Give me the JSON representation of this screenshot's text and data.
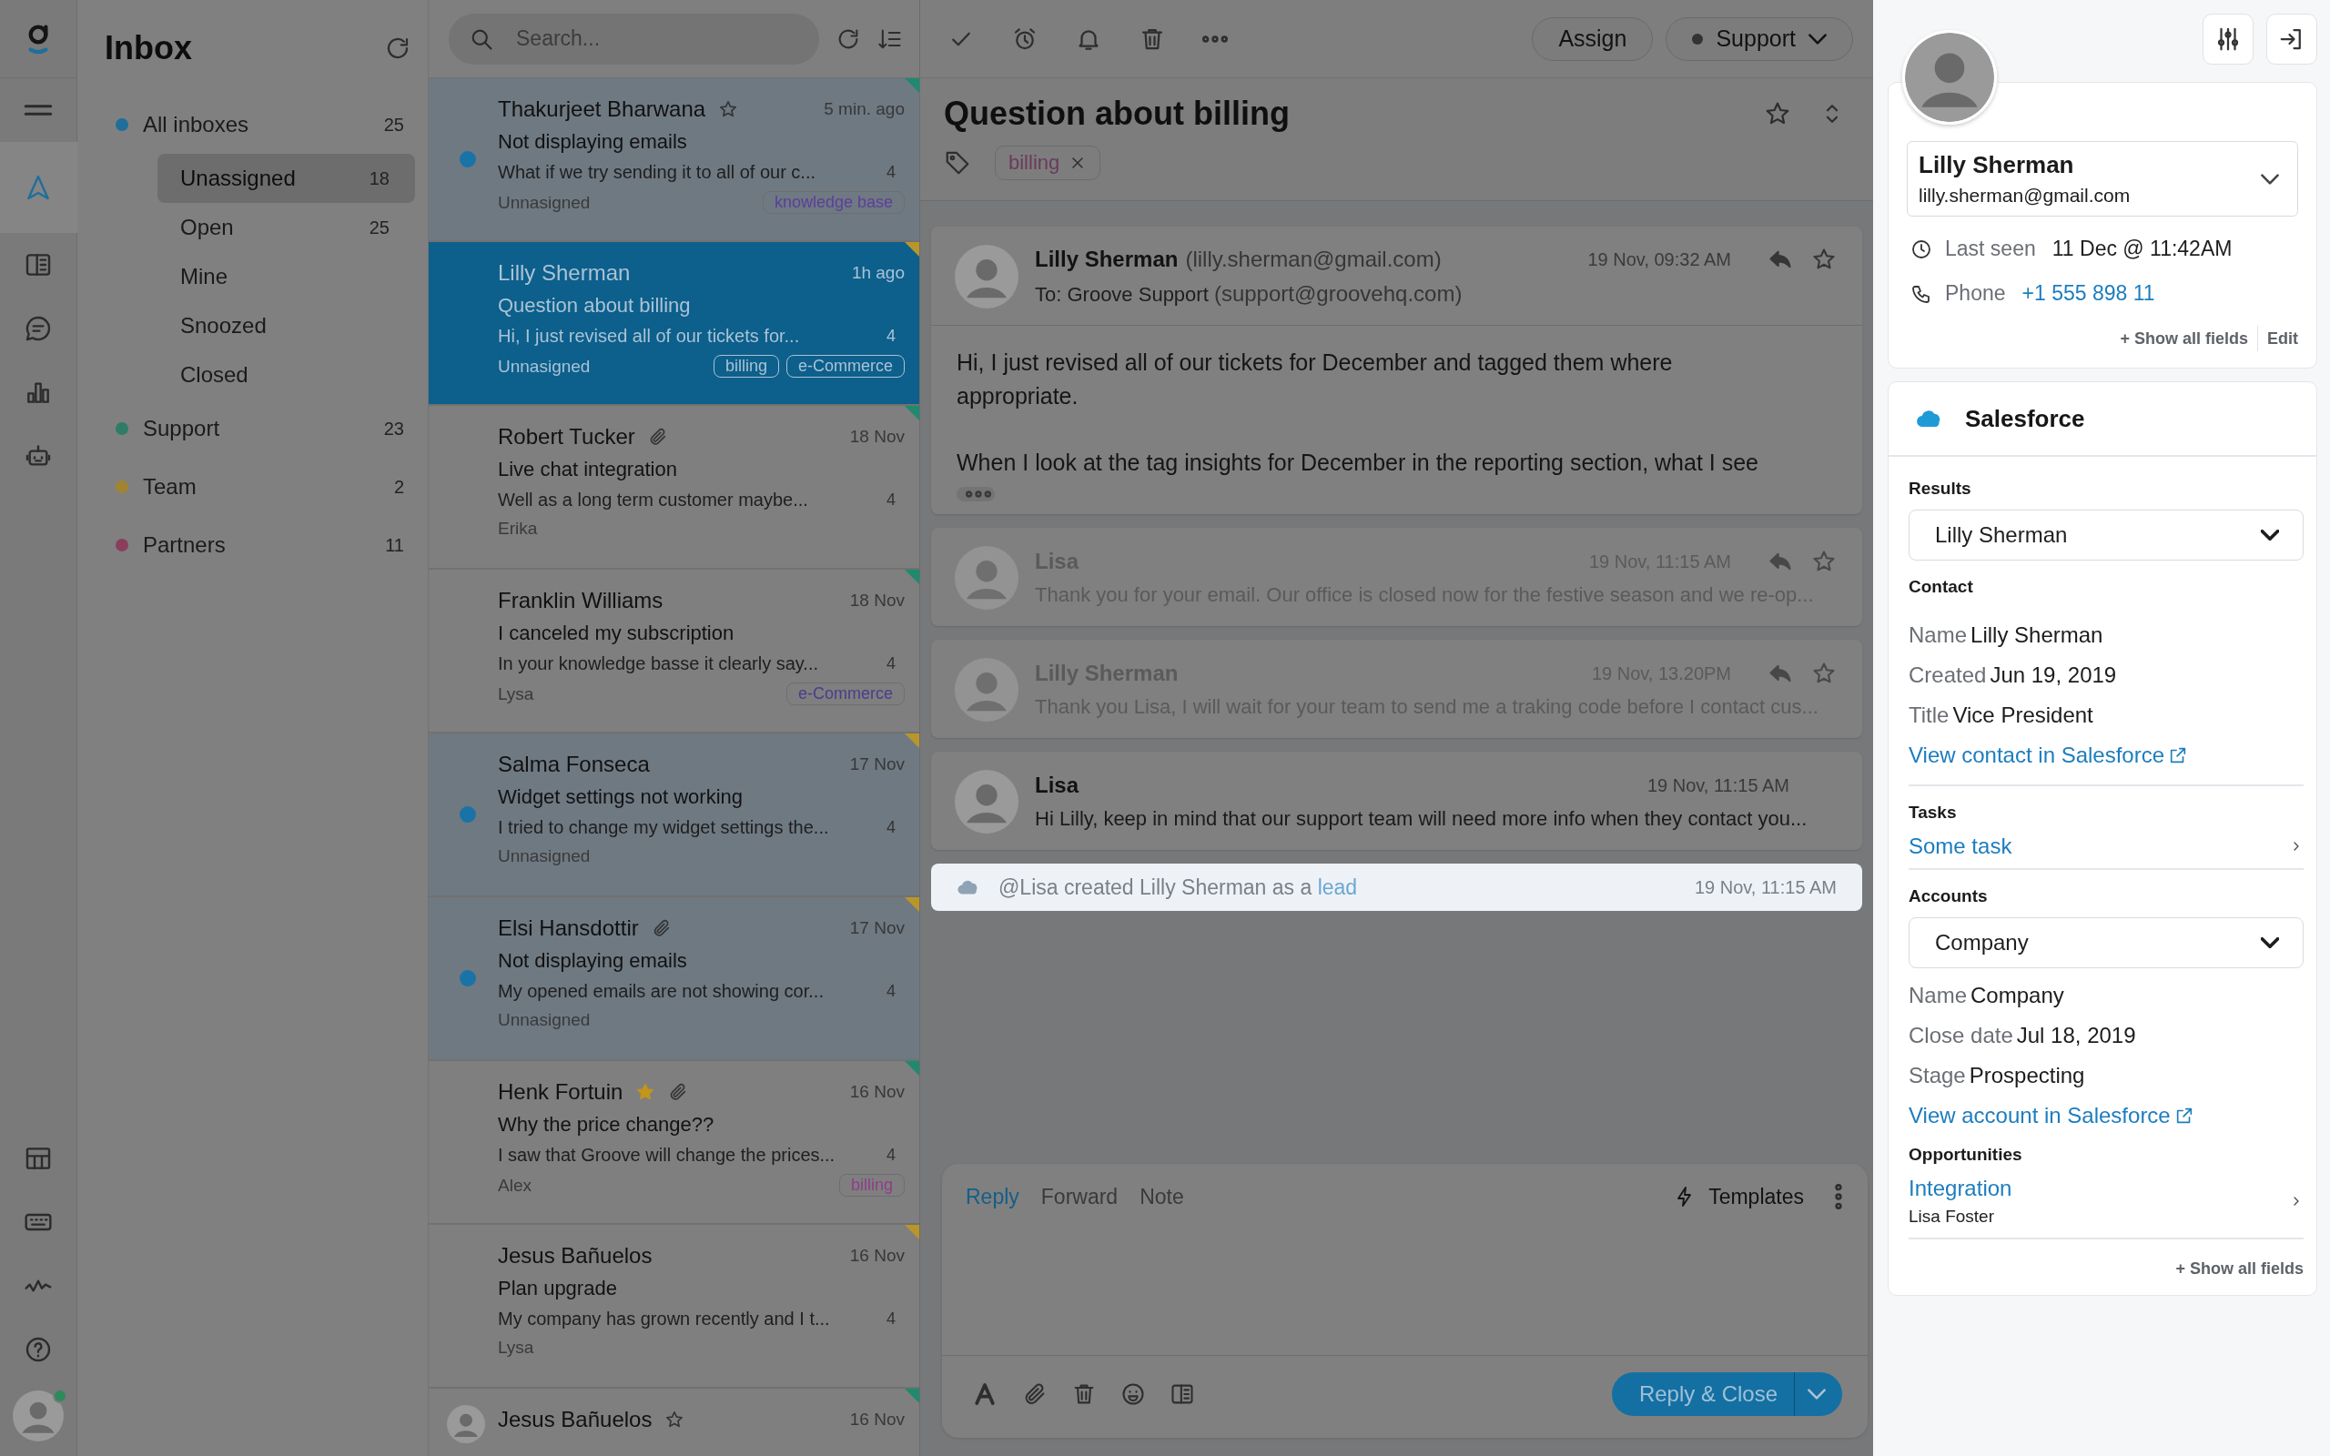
{
  "rail": {
    "top_items": [
      {
        "kind": "menu",
        "selected": false
      },
      {
        "kind": "send",
        "selected": true
      },
      {
        "kind": "book",
        "selected": false
      },
      {
        "kind": "chat",
        "selected": false
      },
      {
        "kind": "chart",
        "selected": false
      },
      {
        "kind": "bot",
        "selected": false
      }
    ],
    "bottom_items": [
      {
        "kind": "table"
      },
      {
        "kind": "keyboard"
      },
      {
        "kind": "activity"
      },
      {
        "kind": "help"
      }
    ],
    "user": {
      "online": true
    }
  },
  "sidebar": {
    "title": "Inbox",
    "items": [
      {
        "label": "All inboxes",
        "count": "25",
        "color": "#1f6f9a",
        "children": [
          {
            "label": "Unassigned",
            "count": "18",
            "selected": true
          },
          {
            "label": "Open",
            "count": "25",
            "selected": false
          },
          {
            "label": "Mine",
            "selected": false
          },
          {
            "label": "Snoozed",
            "selected": false
          },
          {
            "label": "Closed",
            "selected": false
          }
        ]
      },
      {
        "label": "Support",
        "count": "23",
        "color": "#2e7c68"
      },
      {
        "label": "Team",
        "count": "2",
        "color": "#a08432"
      },
      {
        "label": "Partners",
        "count": "11",
        "color": "#8a3e5c"
      }
    ]
  },
  "search": {
    "placeholder": "Search..."
  },
  "conversations": [
    {
      "name": "Thakurjeet Bharwana",
      "starred": false,
      "attachment": false,
      "time": "5 min. ago",
      "subject": "Not displaying emails",
      "preview": "What if we try sending it to all of our c...",
      "count": "4",
      "assignee": "Unnasigned",
      "tags": [
        {
          "label": "knowledge base",
          "color": "#5b3f9a"
        }
      ],
      "unread": true,
      "selected": false,
      "color": "#1f8a6e"
    },
    {
      "name": "Lilly Sherman",
      "attachment": false,
      "time": "1h ago",
      "subject": "Question about billing",
      "preview": "Hi, I just revised all of our tickets for...",
      "count": "4",
      "assignee": "Unnasigned",
      "tags": [
        {
          "label": "billing",
          "color": "#a9c3d4"
        },
        {
          "label": "e-Commerce",
          "color": "#a9c3d4"
        }
      ],
      "unread": false,
      "selected": true,
      "color": "#b8962a"
    },
    {
      "name": "Robert Tucker",
      "attachment": true,
      "time": "18 Nov",
      "subject": "Live chat integration",
      "preview": "Well as a long term customer maybe...",
      "count": "4",
      "assignee": "Erika",
      "unread": false,
      "selected": false,
      "color": "#1f8a6e"
    },
    {
      "name": "Franklin Williams",
      "attachment": false,
      "time": "18 Nov",
      "subject": "I canceled my subscription",
      "preview": "In your knowledge basse it clearly say...",
      "count": "4",
      "assignee": "Lysa",
      "tags": [
        {
          "label": "e-Commerce",
          "color": "#4a3d8c"
        }
      ],
      "unread": false,
      "selected": false,
      "color": "#1f8a6e"
    },
    {
      "name": "Salma Fonseca",
      "attachment": false,
      "time": "17 Nov",
      "subject": "Widget settings not working",
      "preview": "I tried to change my widget settings the...",
      "count": "4",
      "assignee": "Unnasigned",
      "unread": true,
      "selected": false,
      "color": "#b8962a"
    },
    {
      "name": "Elsi Hansdottir",
      "attachment": true,
      "time": "17 Nov",
      "subject": "Not displaying emails",
      "preview": "My opened emails are not showing cor...",
      "count": "4",
      "assignee": "Unnasigned",
      "unread": true,
      "selected": false,
      "color": "#b8962a"
    },
    {
      "name": "Henk Fortuin",
      "starred": true,
      "attachment": true,
      "time": "16 Nov",
      "subject": "Why the price change??",
      "preview": "I saw that Groove will change the prices...",
      "count": "4",
      "assignee": "Alex",
      "tags": [
        {
          "label": "billing",
          "color": "#8e3e8a"
        }
      ],
      "unread": false,
      "selected": false,
      "color": "#1f8a6e"
    },
    {
      "name": "Jesus Bañuelos",
      "attachment": false,
      "time": "16 Nov",
      "subject": "Plan upgrade",
      "preview": "My company has grown recently and I t...",
      "count": "4",
      "assignee": "Lysa",
      "unread": false,
      "selected": false,
      "color": "#b8962a"
    },
    {
      "name": "Jesus Bañuelos",
      "starred": false,
      "avatar": true,
      "attachment": false,
      "time": "16 Nov",
      "unread": false,
      "selected": false,
      "color": "#1f8a6e"
    }
  ],
  "conversation": {
    "toolbar": {
      "assign": "Assign",
      "mailbox": "Support"
    },
    "title": "Question about billing",
    "tags": [
      "billing"
    ],
    "messages": [
      {
        "kind": "expanded",
        "name": "Lilly Sherman",
        "email": "(lilly.sherman@gmail.com)",
        "to": "To: Groove Support",
        "to_email": "(support@groovehq.com)",
        "time": "19 Nov, 09:32 AM",
        "actions": true,
        "faded": false,
        "body": [
          "Hi, I just revised all of our tickets for December and tagged them where appropriate.",
          "When I look at the tag insights for December in the reporting section, what I see"
        ]
      },
      {
        "kind": "collapsed",
        "name": "Lisa",
        "time": "19 Nov, 11:15 AM",
        "actions": true,
        "faded": true,
        "preview": "Thank you for your email. Our office is closed now for the festive season and we re-op..."
      },
      {
        "kind": "collapsed",
        "name": "Lilly Sherman",
        "time": "19 Nov, 13.20PM",
        "actions": true,
        "faded": true,
        "preview": "Thank you Lisa, I will wait for your team to send me a traking code before I contact cus..."
      },
      {
        "kind": "collapsed",
        "name": "Lisa",
        "time": "19 Nov, 11:15 AM",
        "actions": false,
        "faded": false,
        "preview": "Hi Lilly, keep in mind that our support team will need more info when they contact you..."
      },
      {
        "kind": "note",
        "text": "@Lisa created Lilly Sherman as a",
        "link": "lead",
        "time": "19 Nov, 11:15 AM"
      }
    ],
    "composer": {
      "tabs": [
        {
          "label": "Reply",
          "selected": true
        },
        {
          "label": "Forward",
          "selected": false
        },
        {
          "label": "Note",
          "selected": false
        }
      ],
      "templates": "Templates",
      "send": "Reply & Close"
    }
  },
  "contact": {
    "name": "Lilly Sherman",
    "email": "lilly.sherman@gmail.com",
    "last_seen_label": "Last seen",
    "last_seen": "11 Dec @ 11:42AM",
    "phone_label": "Phone",
    "phone": "+1 555 898 11",
    "show_all": "+ Show all fields",
    "edit": "Edit"
  },
  "salesforce": {
    "title": "Salesforce",
    "results_label": "Results",
    "result": "Lilly Sherman",
    "contact_label": "Contact",
    "contact_fields": [
      {
        "label": "Name",
        "value": "Lilly Sherman"
      },
      {
        "label": "Created",
        "value": "Jun 19, 2019"
      },
      {
        "label": "Title",
        "value": "Vice President"
      }
    ],
    "contact_link": "View contact in Salesforce",
    "tasks_label": "Tasks",
    "task": "Some task",
    "accounts_label": "Accounts",
    "account": "Company",
    "account_fields": [
      {
        "label": "Name",
        "value": "Company"
      },
      {
        "label": "Close date",
        "value": "Jul 18, 2019"
      },
      {
        "label": "Stage",
        "value": "Prospecting"
      }
    ],
    "account_link": "View account in Salesforce",
    "opportunities_label": "Opportunities",
    "opportunity": "Integration",
    "opportunity_owner": "Lisa Foster",
    "show_all": "+ Show all fields"
  }
}
